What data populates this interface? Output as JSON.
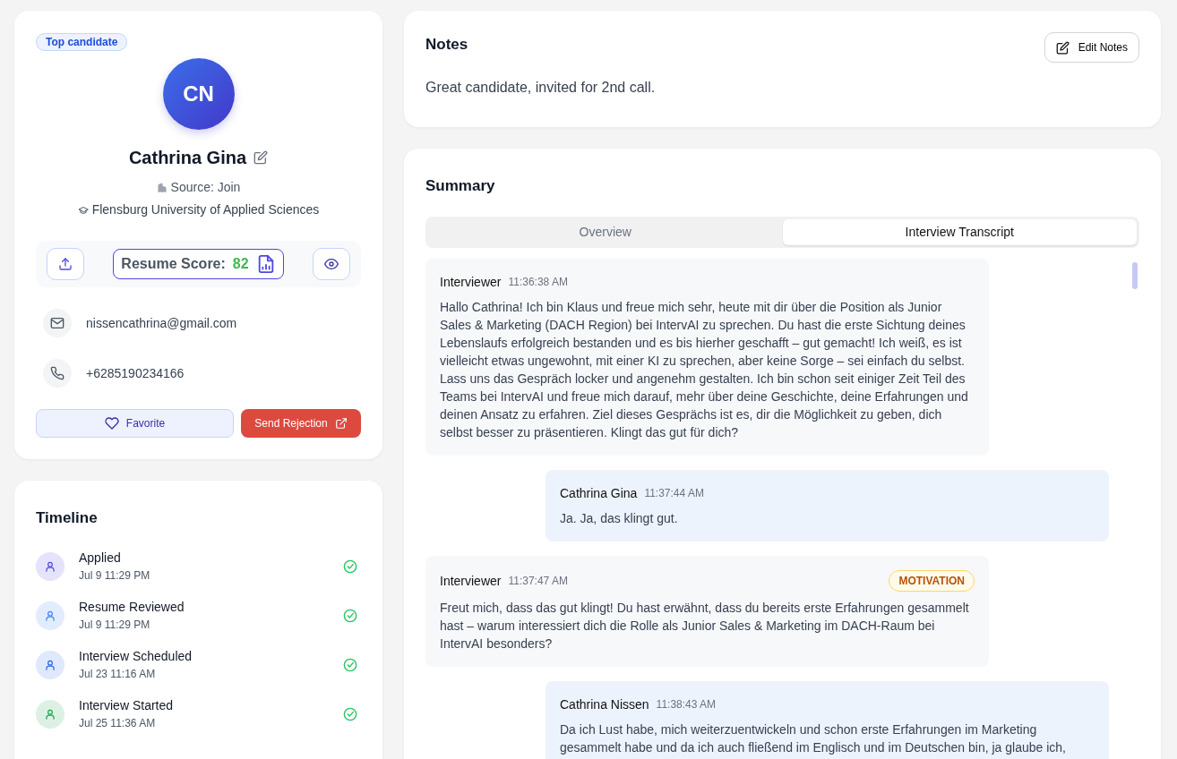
{
  "profile": {
    "badge": "Top candidate",
    "initials": "CN",
    "name": "Cathrina Gina",
    "source": "Source: Join",
    "university": "Flensburg University of Applied Sciences",
    "resume_score_label": "Resume Score:",
    "resume_score": "82",
    "email": "nissencathrina@gmail.com",
    "phone": "+6285190234166",
    "favorite_button": "Favorite",
    "rejection_button": "Send Rejection"
  },
  "timeline": {
    "title": "Timeline",
    "items": [
      {
        "label": "Applied",
        "time": "Jul 9 11:29 PM",
        "color": "#4f46e5",
        "done": true
      },
      {
        "label": "Resume Reviewed",
        "time": "Jul 9 11:29 PM",
        "color": "#3b82f6",
        "done": true
      },
      {
        "label": "Interview Scheduled",
        "time": "Jul 23 11:16 AM",
        "color": "#2563eb",
        "done": true
      },
      {
        "label": "Interview Started",
        "time": "Jul 25 11:36 AM",
        "color": "#16a34a",
        "done": true
      }
    ]
  },
  "notes": {
    "title": "Notes",
    "edit_button": "Edit Notes",
    "text": "Great candidate, invited for 2nd call."
  },
  "summary": {
    "title": "Summary",
    "tabs": [
      {
        "label": "Overview",
        "selected": false
      },
      {
        "label": "Interview Transcript",
        "selected": true
      }
    ],
    "messages": [
      {
        "kind": "interviewer",
        "speaker": "Interviewer",
        "time": "11:36:38 AM",
        "text": "Hallo Cathrina! Ich bin Klaus und freue mich sehr, heute mit dir über die Position als Junior Sales & Marketing (DACH Region) bei IntervAI zu sprechen. Du hast die erste Sichtung deines Lebenslaufs erfolgreich bestanden und es bis hierher geschafft – gut gemacht! Ich weiß, es ist vielleicht etwas ungewohnt, mit einer KI zu sprechen, aber keine Sorge – sei einfach du selbst. Lass uns das Gespräch locker und angenehm gestalten. Ich bin schon seit einiger Zeit Teil des Teams bei IntervAI und freue mich darauf, mehr über deine Geschichte, deine Erfahrungen und deinen Ansatz zu erfahren. Ziel dieses Gesprächs ist es, dir die Möglichkeit zu geben, dich selbst besser zu präsentieren. Klingt das gut für dich?"
      },
      {
        "kind": "candidate",
        "speaker": "Cathrina Gina",
        "time": "11:37:44 AM",
        "text": "Ja. Ja, das klingt gut."
      },
      {
        "kind": "interviewer",
        "speaker": "Interviewer",
        "time": "11:37:47 AM",
        "tag": "MOTIVATION",
        "text": "Freut mich, dass das gut klingt! Du hast erwähnt, dass du bereits erste Erfahrungen gesammelt hast – warum interessiert dich die Rolle als Junior Sales & Marketing im DACH-Raum bei IntervAI besonders?"
      },
      {
        "kind": "candidate",
        "speaker": "Cathrina Nissen",
        "time": "11:38:43 AM",
        "text": "Da ich Lust habe, mich weiterzuentwickeln und schon erste Erfahrungen im Marketing gesammelt habe und da ich auch fließend im Englisch und im Deutschen bin, ja glaube ich,"
      }
    ]
  }
}
